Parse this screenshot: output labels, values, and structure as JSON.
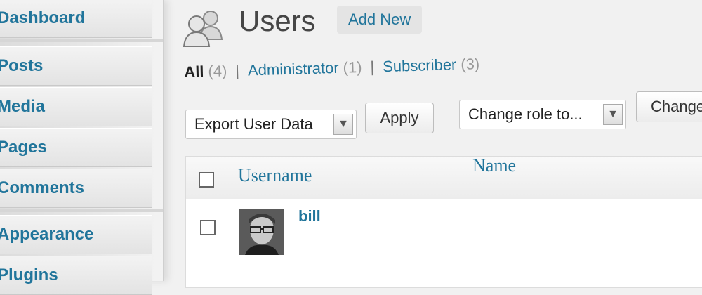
{
  "sidebar": {
    "items": [
      {
        "label": "Dashboard"
      },
      {
        "label": "Posts"
      },
      {
        "label": "Media"
      },
      {
        "label": "Pages"
      },
      {
        "label": "Comments"
      },
      {
        "label": "Appearance"
      },
      {
        "label": "Plugins"
      }
    ]
  },
  "header": {
    "icon": "users-icon",
    "title": "Users",
    "add_new_label": "Add New"
  },
  "views": {
    "all": {
      "label": "All",
      "count": "(4)"
    },
    "administrator": {
      "label": "Administrator",
      "count": "(1)"
    },
    "subscriber": {
      "label": "Subscriber",
      "count": "(3)"
    },
    "separator": "|"
  },
  "bulk_actions": {
    "selected": "Export User Data",
    "apply_label": "Apply"
  },
  "role_change": {
    "selected": "Change role to...",
    "button_label": "Change"
  },
  "table": {
    "columns": [
      "Username",
      "Name"
    ],
    "rows": [
      {
        "username": "bill",
        "avatar": "user-photo"
      }
    ]
  },
  "colors": {
    "link": "#21759b",
    "title": "#464646",
    "background": "#f1f1f1"
  }
}
